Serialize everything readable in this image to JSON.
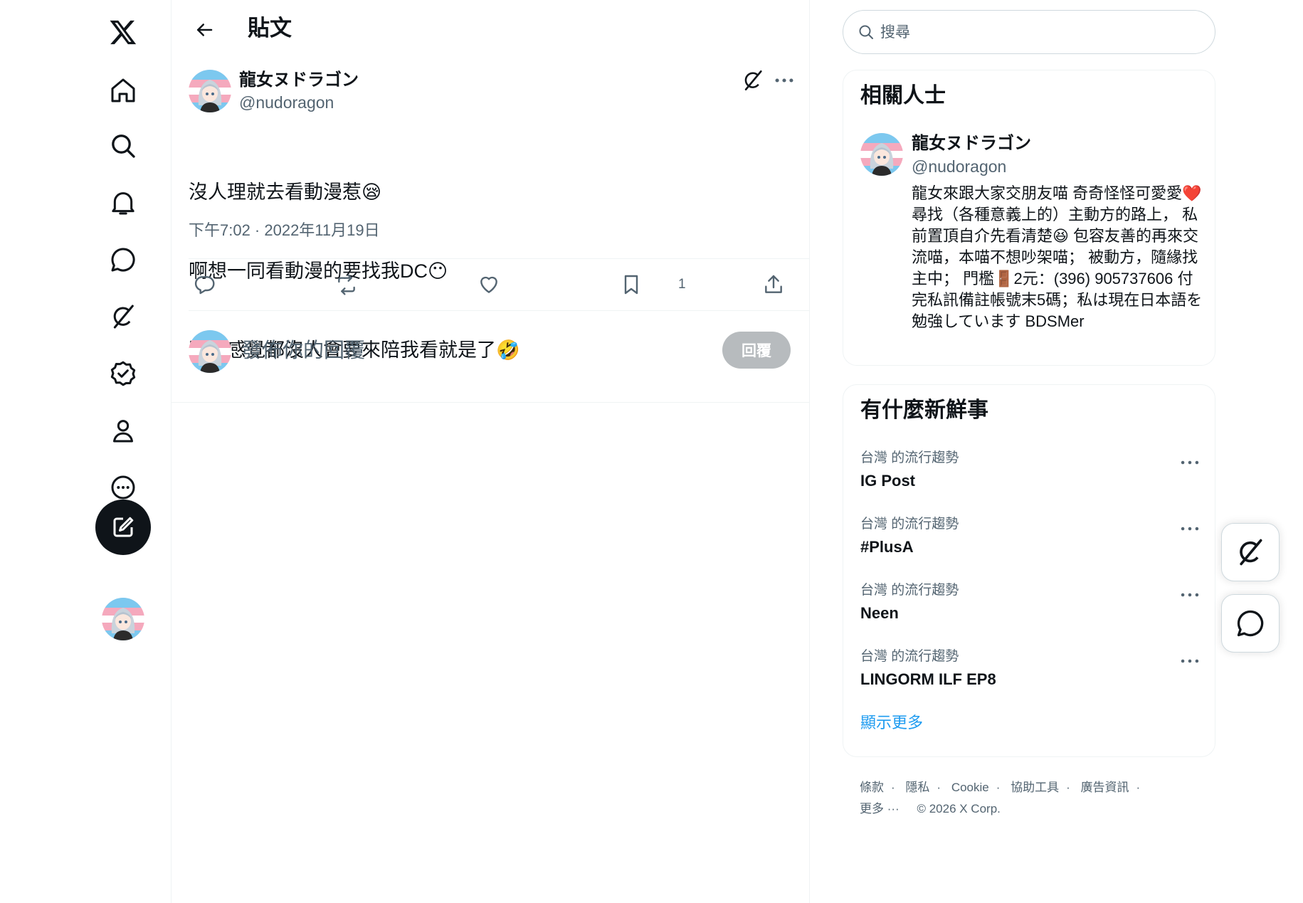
{
  "nav": {
    "logo": "x-logo-icon",
    "items": [
      {
        "icon": "home-icon"
      },
      {
        "icon": "search-icon"
      },
      {
        "icon": "bell-icon"
      },
      {
        "icon": "messages-icon"
      },
      {
        "icon": "grok-icon"
      },
      {
        "icon": "verified-icon"
      },
      {
        "icon": "profile-icon"
      },
      {
        "icon": "more-circle-icon"
      }
    ],
    "compose_icon": "compose-icon"
  },
  "header": {
    "title": "貼文"
  },
  "post": {
    "author_name": "龍女ヌドラゴン",
    "author_handle": "@nudoragon",
    "text_lines": [
      "沒人理就去看動漫惹😪",
      "啊想一同看動漫的要找我DC😶",
      "雖然感覺都沒人會要來陪我看就是了🤣"
    ],
    "timestamp": "下午7:02 · 2022年11月19日",
    "like_count": "1"
  },
  "reply": {
    "placeholder": "發佈你的回覆",
    "button_label": "回覆"
  },
  "search": {
    "placeholder": "搜尋"
  },
  "related": {
    "title": "相關人士",
    "name": "龍女ヌドラゴン",
    "handle": "@nudoragon",
    "bio": "龍女來跟大家交朋友喵 奇奇怪怪可愛愛❤️ 尋找（各種意義上的）主動方的路上， 私前置頂自介先看清楚😆 包容友善的再來交流喵，本喵不想吵架喵； 被動方，隨緣找主中； 門檻🚪2元：(396) 905737606 付完私訊備註帳號末5碼；私は現在日本語を勉強しています BDSMer"
  },
  "trends": {
    "title": "有什麼新鮮事",
    "items": [
      {
        "meta": "台灣 的流行趨勢",
        "name": "IG Post"
      },
      {
        "meta": "台灣 的流行趨勢",
        "name": "#PlusA"
      },
      {
        "meta": "台灣 的流行趨勢",
        "name": "Neen"
      },
      {
        "meta": "台灣 的流行趨勢",
        "name": "LINGORM ILF EP8"
      }
    ],
    "show_more": "顯示更多"
  },
  "footer": {
    "links": [
      "條款",
      "隱私",
      "Cookie",
      "協助工具",
      "廣告資訊",
      "更多 ···"
    ],
    "copyright": "© 2026 X Corp."
  },
  "colors": {
    "accent": "#1d9bf0",
    "text": "#0f1419",
    "muted": "#536471",
    "border": "#eff3f4"
  }
}
